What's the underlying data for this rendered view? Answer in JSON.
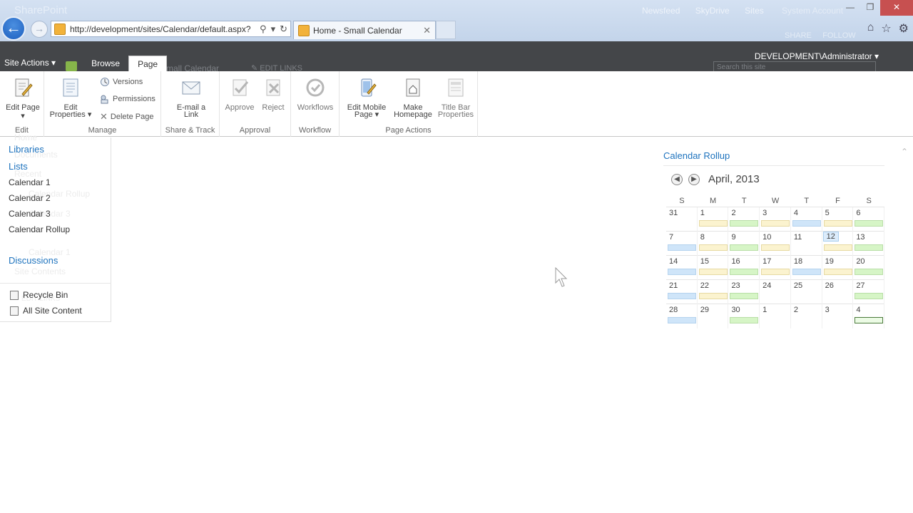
{
  "browser": {
    "url": "http://development/sites/Calendar/default.aspx?",
    "tab_title": "Home - Small Calendar",
    "ghost_suite_title": "SharePoint",
    "ghost_links": [
      "Newsfeed",
      "SkyDrive",
      "Sites"
    ],
    "ghost_account": "System Account",
    "ghost_share": "SHARE",
    "ghost_follow": "FOLLOW"
  },
  "ribbon": {
    "site_actions": "Site Actions",
    "tabs": [
      "Browse",
      "Page"
    ],
    "active_tab": "Page",
    "user": "DEVELOPMENT\\Administrator",
    "ghost_title": "Small Calendar",
    "ghost_edit_links": "EDIT LINKS",
    "ghost_search": "Search this site",
    "groups": {
      "edit": {
        "label": "Edit",
        "edit_page": "Edit Page"
      },
      "manage": {
        "label": "Manage",
        "edit_properties_1": "Edit",
        "edit_properties_2": "Properties",
        "versions": "Versions",
        "permissions": "Permissions",
        "delete_page": "Delete Page"
      },
      "share": {
        "label": "Share & Track",
        "email_1": "E-mail a",
        "email_2": "Link"
      },
      "approval": {
        "label": "Approval",
        "approve": "Approve",
        "reject": "Reject"
      },
      "workflow": {
        "label": "Workflow",
        "workflows": "Workflows"
      },
      "page_actions": {
        "label": "Page Actions",
        "mobile_1": "Edit Mobile",
        "mobile_2": "Page",
        "homepage_1": "Make",
        "homepage_2": "Homepage",
        "titlebar_1": "Title Bar",
        "titlebar_2": "Properties"
      }
    }
  },
  "nav": {
    "libraries": "Libraries",
    "lists": "Lists",
    "list_items": [
      "Calendar 1",
      "Calendar 2",
      "Calendar 3",
      "Calendar Rollup"
    ],
    "discussions": "Discussions",
    "recycle_bin": "Recycle Bin",
    "all_site_content": "All Site Content",
    "ghost": [
      "Home",
      "Documents",
      "Recent",
      "Calendar Rollup",
      "Calendar 3",
      "Calendar 1",
      "Site Contents",
      "EDIT LINKS"
    ]
  },
  "calendar": {
    "title": "Calendar Rollup",
    "month": "April, 2013",
    "dow": [
      "S",
      "M",
      "T",
      "W",
      "T",
      "F",
      "S"
    ],
    "weeks": [
      [
        {
          "d": "31",
          "e": ""
        },
        {
          "d": "1",
          "e": "yellow"
        },
        {
          "d": "2",
          "e": "green"
        },
        {
          "d": "3",
          "e": "yellow"
        },
        {
          "d": "4",
          "e": "blue"
        },
        {
          "d": "5",
          "e": "yellow"
        },
        {
          "d": "6",
          "e": "green"
        }
      ],
      [
        {
          "d": "7",
          "e": "blue"
        },
        {
          "d": "8",
          "e": "yellow"
        },
        {
          "d": "9",
          "e": "green"
        },
        {
          "d": "10",
          "e": "yellow"
        },
        {
          "d": "11",
          "e": ""
        },
        {
          "d": "12",
          "e": "yellow",
          "today": true
        },
        {
          "d": "13",
          "e": "green"
        }
      ],
      [
        {
          "d": "14",
          "e": "blue"
        },
        {
          "d": "15",
          "e": "yellow"
        },
        {
          "d": "16",
          "e": "green"
        },
        {
          "d": "17",
          "e": "yellow"
        },
        {
          "d": "18",
          "e": "blue"
        },
        {
          "d": "19",
          "e": "yellow"
        },
        {
          "d": "20",
          "e": "green"
        }
      ],
      [
        {
          "d": "21",
          "e": "blue"
        },
        {
          "d": "22",
          "e": "yellow"
        },
        {
          "d": "23",
          "e": "green"
        },
        {
          "d": "24",
          "e": ""
        },
        {
          "d": "25",
          "e": ""
        },
        {
          "d": "26",
          "e": ""
        },
        {
          "d": "27",
          "e": "green"
        }
      ],
      [
        {
          "d": "28",
          "e": "blue"
        },
        {
          "d": "29",
          "e": ""
        },
        {
          "d": "30",
          "e": "green"
        },
        {
          "d": "1",
          "e": ""
        },
        {
          "d": "2",
          "e": ""
        },
        {
          "d": "3",
          "e": ""
        },
        {
          "d": "4",
          "e": "gbox"
        }
      ]
    ]
  }
}
